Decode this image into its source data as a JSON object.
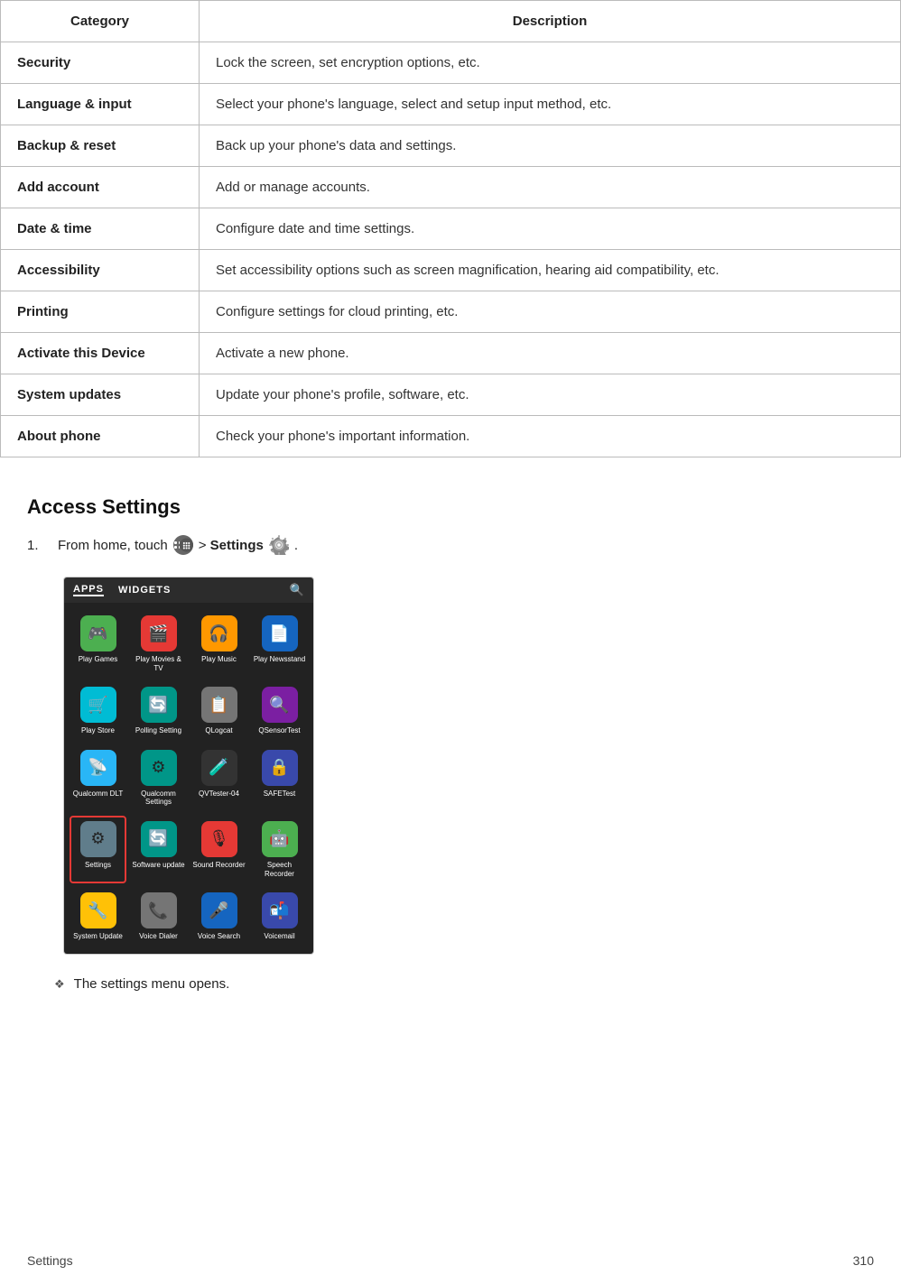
{
  "table": {
    "headers": [
      "Category",
      "Description"
    ],
    "rows": [
      {
        "category": "Security",
        "description": "Lock the screen, set encryption options, etc."
      },
      {
        "category": "Language & input",
        "description": "Select your phone's language, select and setup input method, etc."
      },
      {
        "category": "Backup & reset",
        "description": "Back up your phone's data and settings."
      },
      {
        "category": "Add account",
        "description": "Add or manage accounts."
      },
      {
        "category": "Date & time",
        "description": "Configure date and time settings."
      },
      {
        "category": "Accessibility",
        "description": "Set accessibility options such as screen magnification, hearing aid compatibility, etc."
      },
      {
        "category": "Printing",
        "description": "Configure settings for cloud printing, etc."
      },
      {
        "category": "Activate this Device",
        "description": "Activate a new phone."
      },
      {
        "category": "System updates",
        "description": "Update your phone's profile, software, etc."
      },
      {
        "category": "About phone",
        "description": "Check your phone's important information."
      }
    ]
  },
  "access_section": {
    "title": "Access Settings",
    "step_prefix": "From home, touch",
    "step_middle": "> Settings",
    "step_number": "1.",
    "bullet_text": "The settings menu opens."
  },
  "phone_ui": {
    "tabs": [
      "APPS",
      "WIDGETS"
    ],
    "apps": [
      {
        "label": "Play Games",
        "color": "bg-green",
        "icon": "🎮"
      },
      {
        "label": "Play Movies & TV",
        "color": "bg-red",
        "icon": "🎬"
      },
      {
        "label": "Play Music",
        "color": "bg-orange",
        "icon": "🎧"
      },
      {
        "label": "Play Newsstand",
        "color": "bg-blue",
        "icon": "📄"
      },
      {
        "label": "Play Store",
        "color": "bg-cyan",
        "icon": "🛒"
      },
      {
        "label": "Polling Setting",
        "color": "bg-teal",
        "icon": "🔄"
      },
      {
        "label": "QLogcat",
        "color": "bg-grey",
        "icon": "📋"
      },
      {
        "label": "QSensorTest",
        "color": "bg-purple",
        "icon": "🔍"
      },
      {
        "label": "Qualcomm DLT",
        "color": "bg-lightblue",
        "icon": "📡"
      },
      {
        "label": "Qualcomm Settings",
        "color": "bg-teal",
        "icon": "⚙"
      },
      {
        "label": "QVTester-04",
        "color": "bg-dark",
        "icon": "🧪"
      },
      {
        "label": "SAFETest",
        "color": "bg-indigo",
        "icon": "🔒"
      },
      {
        "label": "Settings",
        "color": "bg-settings",
        "icon": "⚙",
        "highlighted": true
      },
      {
        "label": "Software update",
        "color": "bg-teal",
        "icon": "🔄"
      },
      {
        "label": "Sound Recorder",
        "color": "bg-red",
        "icon": "🎙"
      },
      {
        "label": "Speech Recorder",
        "color": "bg-green",
        "icon": "🤖"
      },
      {
        "label": "System Update",
        "color": "bg-amber",
        "icon": "🔧"
      },
      {
        "label": "Voice Dialer",
        "color": "bg-grey",
        "icon": "📞"
      },
      {
        "label": "Voice Search",
        "color": "bg-blue",
        "icon": "🎤"
      },
      {
        "label": "Voicemail",
        "color": "bg-indigo",
        "icon": "📬"
      }
    ]
  },
  "footer": {
    "left": "Settings",
    "right": "310"
  }
}
